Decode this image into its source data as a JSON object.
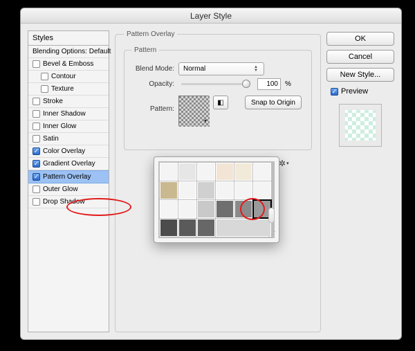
{
  "window": {
    "title": "Layer Style"
  },
  "sidebar": {
    "header": "Styles",
    "blending_row": "Blending Options: Default",
    "items": [
      {
        "label": "Bevel & Emboss",
        "checked": false,
        "indent": 0
      },
      {
        "label": "Contour",
        "checked": false,
        "indent": 1
      },
      {
        "label": "Texture",
        "checked": false,
        "indent": 1
      },
      {
        "label": "Stroke",
        "checked": false,
        "indent": 0
      },
      {
        "label": "Inner Shadow",
        "checked": false,
        "indent": 0
      },
      {
        "label": "Inner Glow",
        "checked": false,
        "indent": 0
      },
      {
        "label": "Satin",
        "checked": false,
        "indent": 0
      },
      {
        "label": "Color Overlay",
        "checked": true,
        "indent": 0
      },
      {
        "label": "Gradient Overlay",
        "checked": true,
        "indent": 0
      },
      {
        "label": "Pattern Overlay",
        "checked": true,
        "indent": 0,
        "selected": true
      },
      {
        "label": "Outer Glow",
        "checked": false,
        "indent": 0
      },
      {
        "label": "Drop Shadow",
        "checked": false,
        "indent": 0
      }
    ]
  },
  "center": {
    "outer_legend": "Pattern Overlay",
    "inner_legend": "Pattern",
    "blend_mode_label": "Blend Mode:",
    "blend_mode_value": "Normal",
    "opacity_label": "Opacity:",
    "opacity_value": "100",
    "opacity_unit": "%",
    "pattern_label": "Pattern:",
    "snap_label": "Snap to Origin"
  },
  "popover": {
    "patterns": [
      "checker-light",
      "diagonal",
      "blank",
      "peach",
      "cream",
      "blank2",
      "stones",
      "blank3",
      "grey",
      "blank4",
      "blank5",
      "blank6",
      "blank7",
      "blank8",
      "grey2",
      "darkgrid",
      "cross",
      "selected-grid",
      "dark1",
      "dark2",
      "dark3"
    ],
    "selected_index": 17
  },
  "right": {
    "ok": "OK",
    "cancel": "Cancel",
    "new_style": "New Style...",
    "preview_label": "Preview"
  }
}
